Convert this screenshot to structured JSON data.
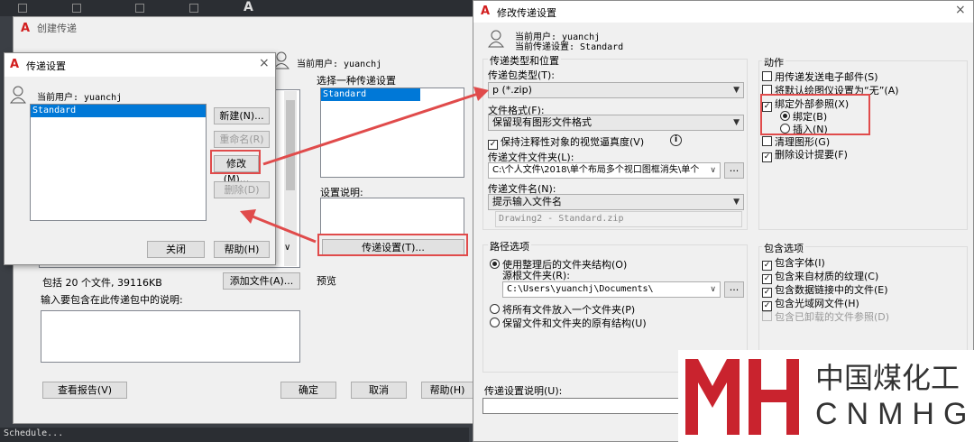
{
  "top_toolbar": {
    "icon_label": "A"
  },
  "status_bar": {
    "text": "Schedule..."
  },
  "create_dialog": {
    "title": "创建传递",
    "current_user": "当前用户: yuanchj",
    "select_setting_label": "选择一种传递设置",
    "setting_item": "Standard",
    "setting_desc_label": "设置说明:",
    "transmittal_setup_button": "传递设置(T)...",
    "preview_label": "预览",
    "files_info": "包括 20 个文件, 39116KB",
    "add_file_button": "添加文件(A)...",
    "notes_label": "输入要包含在此传递包中的说明:",
    "view_report_button": "查看报告(V)",
    "ok_button": "确定",
    "cancel_button": "取消",
    "help_button": "帮助(H)"
  },
  "setup_dialog": {
    "title": "传递设置",
    "current_user": "当前用户: yuanchj",
    "list_item": "Standard",
    "new_button": "新建(N)...",
    "rename_button": "重命名(R)",
    "modify_button": "修改(M)...",
    "delete_button": "删除(D)",
    "close_button": "关闭",
    "help_button": "帮助(H)",
    "scroll_down": "∨"
  },
  "modify_dialog": {
    "title": "修改传递设置",
    "current_user": "当前用户: yuanchj",
    "current_setting": "当前传递设置: Standard",
    "type_group_label": "传递类型和位置",
    "package_type_label": "传递包类型(T):",
    "package_type_value": "p (*.zip)",
    "file_format_label": "文件格式(F):",
    "file_format_value": "保留现有图形文件格式",
    "keep_annotative_label": "保持注释性对象的视觉逼真度(V)",
    "folder_label": "传递文件文件夹(L):",
    "folder_value": "C:\\个人文件\\2018\\单个布局多个视口图框消失\\单个",
    "filename_label": "传递文件名(N):",
    "filename_value": "提示输入文件名",
    "filename_preview": "Drawing2 - Standard.zip",
    "path_group_label": "路径选项",
    "path_opt1": "使用整理后的文件夹结构(O)",
    "source_root_label": "源根文件夹(R):",
    "source_root_value": "C:\\Users\\yuanchj\\Documents\\",
    "path_opt2": "将所有文件放入一个文件夹(P)",
    "path_opt3": "保留文件和文件夹的原有结构(U)",
    "action_group_label": "动作",
    "act_email": "用传递发送电子邮件(S)",
    "act_plotter": "将默认绘图仪设置为“无”(A)",
    "act_bind_xref": "绑定外部参照(X)",
    "act_bind": "绑定(B)",
    "act_insert": "插入(N)",
    "act_purge": "清理图形(G)",
    "act_remove_design": "删除设计提要(F)",
    "include_group_label": "包含选项",
    "inc_fonts": "包含字体(I)",
    "inc_textures": "包含来自材质的纹理(C)",
    "inc_datalinks": "包含数据链接中的文件(E)",
    "inc_photometric": "包含光域网文件(H)",
    "inc_unloaded": "包含已卸载的文件参照(D)",
    "desc_label": "传递设置说明(U):",
    "browse": "..."
  },
  "watermark": {
    "chinese": "中国煤化工",
    "latin": "CNMHG"
  },
  "colors": {
    "accent": "#0078d7",
    "highlight_red": "#e04b4b",
    "brand_red": "#d21e1e"
  }
}
